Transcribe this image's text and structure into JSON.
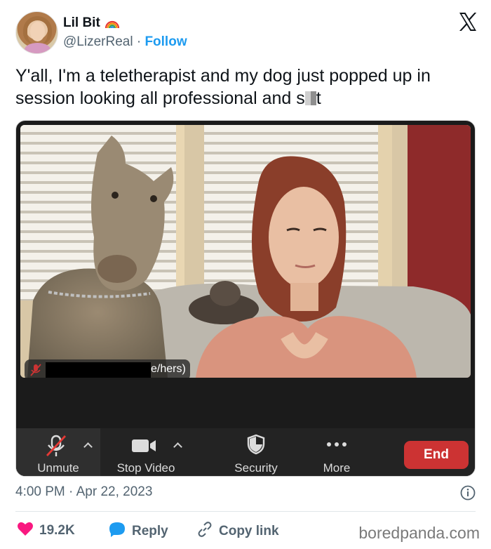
{
  "colors": {
    "follow": "#1d9bf0",
    "like": "#f91880",
    "reply": "#1d9bf0",
    "end_button": "#cc3333",
    "secondary_text": "#536471"
  },
  "tweet": {
    "author": {
      "display_name": "Lil Bit",
      "name_emoji_icon": "rainbow-icon",
      "handle": "@LizerReal",
      "separator": "·",
      "follow_label": "Follow"
    },
    "text_before_censor": "Y'all, I'm a teletherapist and my dog just popped up in session looking all professional and s",
    "text_after_censor": "t",
    "timestamp": "4:00 PM · Apr 22, 2023"
  },
  "video_call": {
    "participant_pronouns": "e/hers)",
    "toolbar": {
      "unmute_label": "Unmute",
      "stop_video_label": "Stop Video",
      "security_label": "Security",
      "more_label": "More",
      "end_label": "End"
    }
  },
  "actions": {
    "likes_count": "19.2K",
    "reply_label": "Reply",
    "copy_link_label": "Copy link"
  },
  "watermark": "boredpanda.com"
}
